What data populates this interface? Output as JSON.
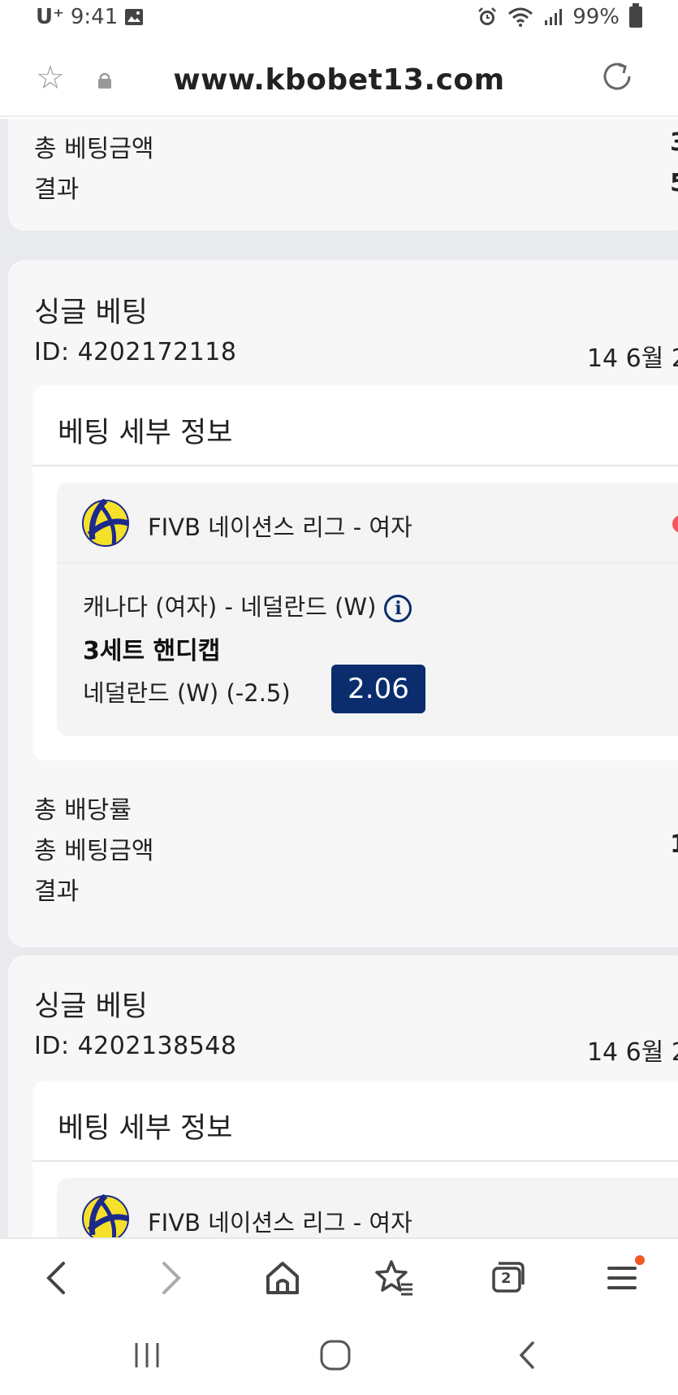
{
  "status_bar": {
    "carrier": "U⁺",
    "time": "9:41",
    "battery": "99%"
  },
  "url_bar": {
    "url": "www.kbobet13.com"
  },
  "top_partial_card": {
    "rows": [
      {
        "label": "총 베팅금액",
        "value": "3"
      },
      {
        "label": "결과",
        "value": "5"
      }
    ]
  },
  "bets": [
    {
      "title": "싱글 베팅",
      "id": "ID: 4202172118",
      "date": "14 6월 2",
      "detail_title": "베팅 세부 정보",
      "league": "FIVB 네이션스 리그 - 여자",
      "match": "캐나다 (여자) - 네덜란드 (W)",
      "market": "3세트 핸디캡",
      "selection": "네덜란드 (W) (-2.5)",
      "odds": "2.06",
      "summary": [
        {
          "label": "총 배당률",
          "value": ""
        },
        {
          "label": "총 베팅금액",
          "value": "1"
        },
        {
          "label": "결과",
          "value": ""
        }
      ]
    },
    {
      "title": "싱글 베팅",
      "id": "ID: 4202138548",
      "date": "14 6월 2",
      "detail_title": "베팅 세부 정보",
      "league": "FIVB 네이션스 리그 - 여자"
    }
  ],
  "bottom_nav": {
    "tab_count": "2"
  },
  "colors": {
    "odds_bg": "#0b2d6e",
    "live_dot": "#f4565b",
    "badge": "#ee5a22"
  }
}
